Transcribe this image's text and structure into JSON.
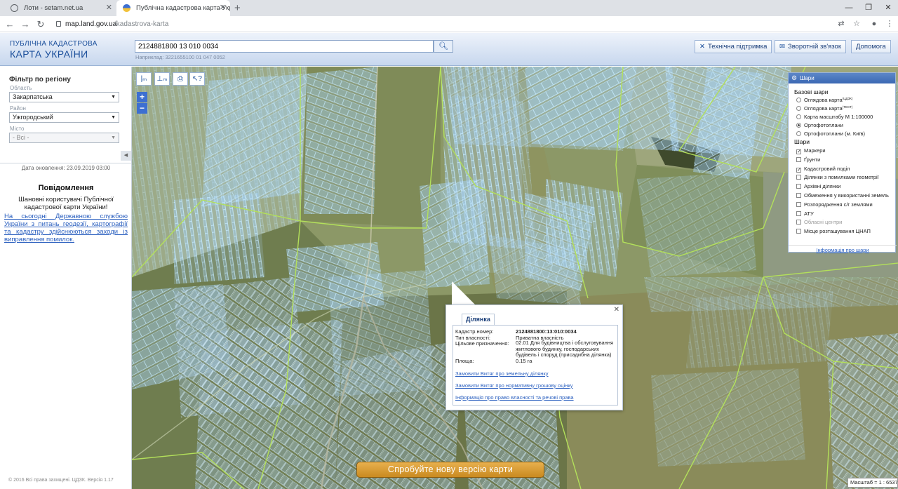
{
  "browser": {
    "tabs": [
      {
        "label": "Лоти - setam.net.ua"
      },
      {
        "label": "Публічна кадастрова карта Укр"
      }
    ],
    "url_host": "map.land.gov.ua",
    "url_path": "/kadastrova-karta"
  },
  "header": {
    "brand_line1": "ПУБЛІЧНА КАДАСТРОВА",
    "brand_line2": "КАРТА УКРАЇНИ",
    "search_value": "2124881800 13 010 0034",
    "search_hint": "Наприклад: 3221655100 01 047 0052",
    "buttons": {
      "support": "Технічна підтримка",
      "feedback": "Зворотній зв'язок",
      "help": "Допомога"
    }
  },
  "sidebar": {
    "filter_title": "Фільтр по регіону",
    "region_label": "Область",
    "region_value": "Закарпатська",
    "district_label": "Район",
    "district_value": "Ужгородський",
    "city_label": "Місто",
    "city_value": "- Всі -",
    "updated": "Дата оновлення: 23.09.2019 03:00",
    "notice_title": "Повідомлення",
    "notice_body": "Шановні користувачі Публічної кадастрової карти України!",
    "notice_link": "На сьогодні Державною службою України з питань геодезії, картографії та кадастру здійснюються заходи із виправлення помилок.",
    "copyright": "© 2016 Всі права захищені. ЦДЗК. Версія 1.17"
  },
  "layers": {
    "title": "Шари",
    "base_title": "Базові шари",
    "base": [
      {
        "label": "Оглядова карта",
        "sup": "(ЦДЗК)",
        "checked": false
      },
      {
        "label": "Оглядова карта",
        "sup": "(ТЕСТ)",
        "checked": false
      },
      {
        "label": "Карта масштабу М 1:100000",
        "sup": "",
        "checked": false
      },
      {
        "label": "Ортофотоплани",
        "sup": "",
        "checked": true
      },
      {
        "label": "Ортофотоплани (м. Київ)",
        "sup": "",
        "checked": false
      }
    ],
    "layers_title": "Шари",
    "items": [
      {
        "label": "Маркери",
        "checked": true,
        "dim": false
      },
      {
        "label": "Ґрунти",
        "checked": false,
        "dim": false
      },
      {
        "label": "Кадастровий поділ",
        "checked": true,
        "dim": false
      },
      {
        "label": "Ділянки з помилками геометрії",
        "checked": false,
        "dim": false
      },
      {
        "label": "Архівні ділянки",
        "checked": false,
        "dim": false
      },
      {
        "label": "Обмеження у використанні земель",
        "checked": false,
        "dim": false
      },
      {
        "label": "Розпорядження с/г землями",
        "checked": false,
        "dim": false
      },
      {
        "label": "АТУ",
        "checked": false,
        "dim": false
      },
      {
        "label": "Обласні центри",
        "checked": false,
        "dim": true
      },
      {
        "label": "Місце розташування ЦНАП",
        "checked": false,
        "dim": false
      }
    ],
    "info_link": "Інформація про шари"
  },
  "popup": {
    "tab": "Ділянка",
    "cadnum_label": "Кадастр.номер:",
    "cadnum_value": "2124881800:13:010:0034",
    "owner_label": "Тип власності:",
    "owner_value": "Приватна власність",
    "purpose_label": "Цільове призначення:",
    "purpose_value": "02.01 Для будівництва і обслуговування житлового будинку, господарських будівель і споруд (присадибна ділянка)",
    "area_label": "Площа:",
    "area_value": "0.15 га",
    "link1": "Замовити Витяг про земельну ділянку",
    "link2": "Замовити Витяг про нормативну грошову оцінку",
    "link3": "Інформація про право власності та речові права"
  },
  "map": {
    "new_version": "Спробуйте нову версію карти",
    "scale": "Масштаб = 1 : 6537"
  }
}
